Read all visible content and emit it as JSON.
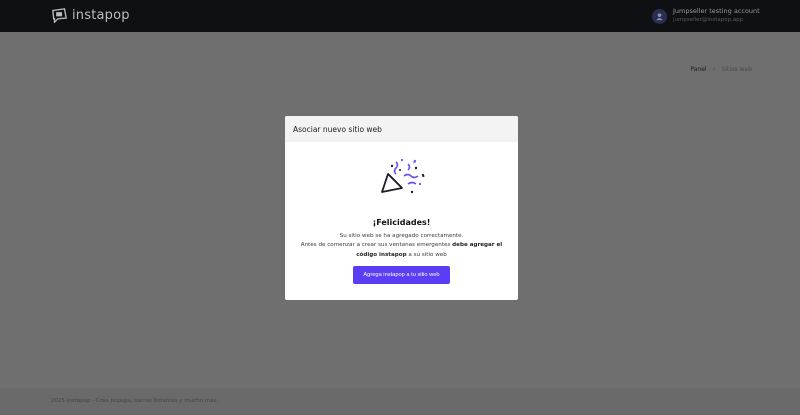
{
  "header": {
    "logo_text": "instapop",
    "logo_icon": "instapop-logo-icon",
    "account_name": "Jumpseller testing account",
    "account_email": "jumpseller@instapop.app",
    "avatar_icon": "user-avatar-icon"
  },
  "breadcrumb": {
    "items": [
      "Panel",
      "Sitios web"
    ],
    "separator": "›"
  },
  "modal": {
    "title": "Asociar nuevo sitio web",
    "illustration_icon": "party-popper-icon",
    "heading": "¡Felicidades!",
    "line1": "Su sitio web se ha agregado correctamente.",
    "line2_prefix": "Antes de comenzar a crear sus ventanas emergentes ",
    "line2_bold": "debe agregar el código instapop",
    "line2_suffix": " a su sitio web",
    "button_label": "Agrega instapop a tu sitio web"
  },
  "footer": {
    "text": "2025 instapop - Crea popups, barras flotantes y mucho más."
  },
  "colors": {
    "accent": "#5b3df5",
    "topbar": "#0f1013",
    "overlay": "#6f6f6f"
  }
}
